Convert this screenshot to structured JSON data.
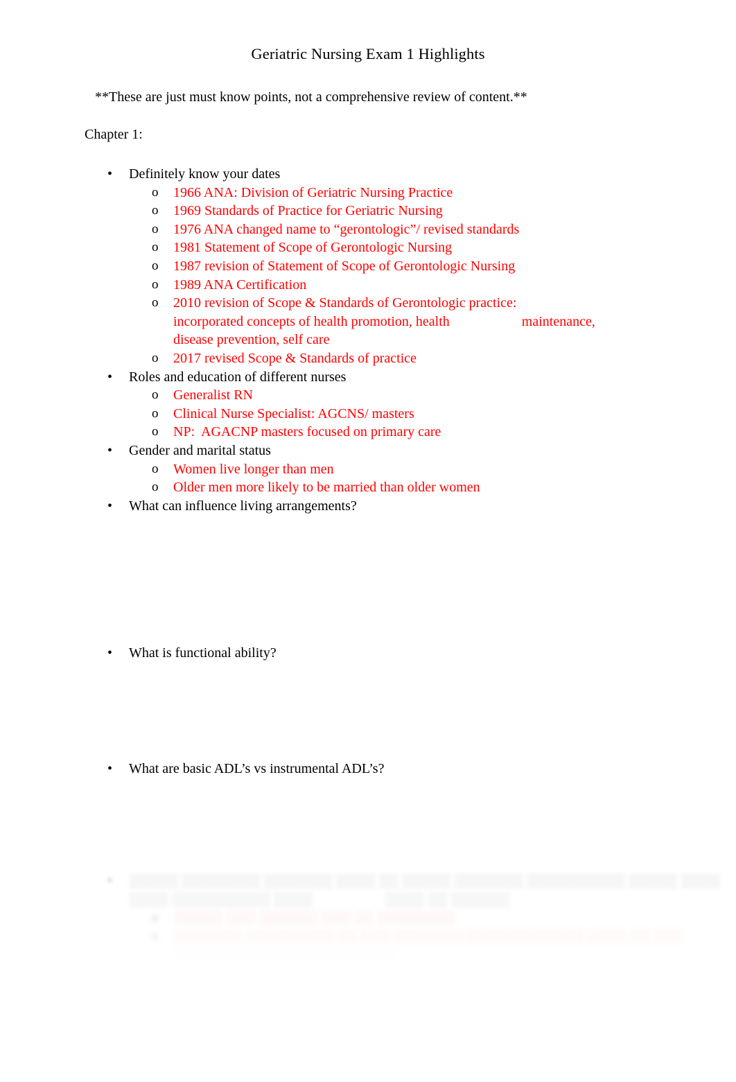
{
  "document": {
    "title": "Geriatric Nursing Exam 1 Highlights",
    "intro_note": "**These are just must know points, not a comprehensive review of content.**",
    "chapter_heading": "Chapter 1:"
  },
  "markers": {
    "bullet": "•",
    "sub_bullet": "o"
  },
  "colors": {
    "body_text": "#000000",
    "answer_text": "#ff0000",
    "page_background": "#ffffff"
  },
  "outline": {
    "dates_item": {
      "label": "Definitely know your dates",
      "sub_items": [
        "1966 ANA: Division of Geriatric Nursing Practice",
        "1969 Standards of Practice for Geriatric Nursing",
        "1976 ANA changed name to “gerontologic”/ revised standards",
        "1981 Statement of Scope of Gerontologic Nursing",
        "1987 revision of Statement of Scope of Gerontologic Nursing",
        "1989 ANA Certification"
      ],
      "item_2010_line1": "2010 revision of Scope & Standards of Gerontologic practice:",
      "item_2010_line2a": "incorporated concepts of health promotion, health",
      "item_2010_line2b": "maintenance,",
      "item_2010_line3": "disease prevention, self care",
      "item_2017": "2017 revised Scope & Standards of practice"
    },
    "roles_item": {
      "label": "Roles and education of different nurses",
      "sub_items": [
        "Generalist RN",
        "Clinical Nurse Specialist: AGCNS/ masters"
      ],
      "np_prefix": "NP:",
      "np_text": "AGACNP masters focused on primary care"
    },
    "gender_item": {
      "label": "Gender and marital status",
      "sub_items": [
        "Women live longer than men",
        "Older men more likely to be married than older women"
      ]
    },
    "question_living": "What can influence living arrangements?",
    "question_functional": "What is functional ability?",
    "question_adl": "What are basic ADL’s vs instrumental ADL’s?"
  },
  "faded_bottom": {
    "note": "text is blurred and faded at the page cut-off; not legible",
    "line_1": "░░░░░ ░░░░░░░░ ░░░░░░░ ░░░░ ░░ ░░░░░ ░░░░░░░ ░░░░░░░░░░ ░░░░░ ░░░░",
    "line_2": "░░░░ ░░░░░░░░░░ ░░░░",
    "line_2b": "░░░░ ░░ ░░░░░░",
    "sub_1": "░░░░░ ░░░ ░░░░░░ ░░░ ░░ ░░░░░░░░",
    "sub_2_line1": "░░░░░░░ ░░░░░░░░░ ░░ ░░░ ░░░░░░░ ░░░░░░░░░░░░ ░░░░ ░░ ░░░",
    "sub_2_line2": "░░░░░░░░ ░░░░░░░░░ ░░░░░"
  }
}
